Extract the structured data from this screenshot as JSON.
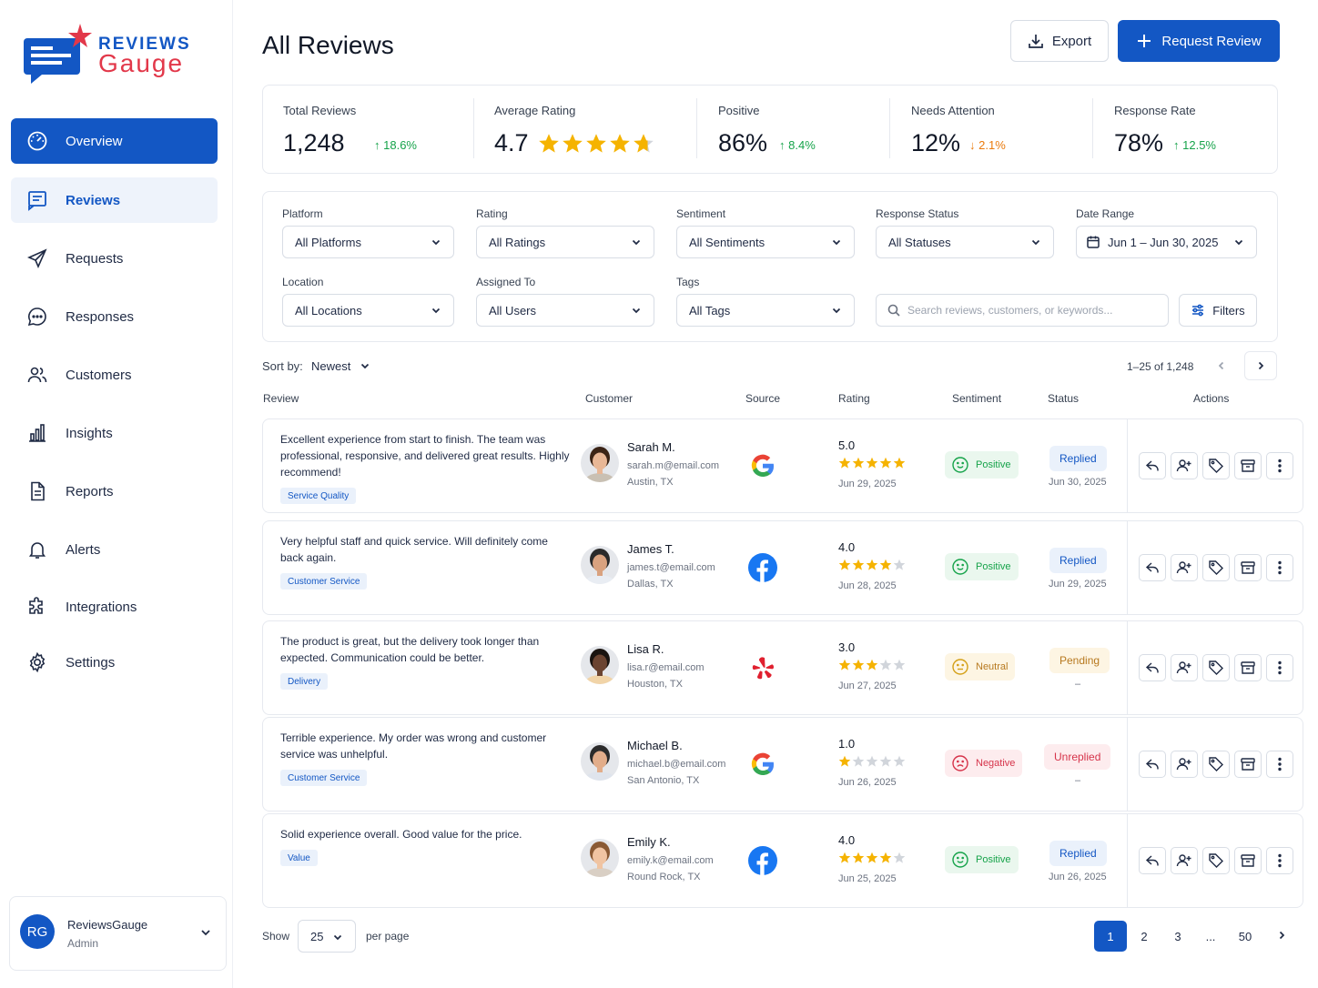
{
  "brand": {
    "line1": "REVIEWS",
    "line2": "Gauge"
  },
  "nav": [
    {
      "label": "Overview",
      "icon": "gauge-icon"
    },
    {
      "label": "Reviews",
      "icon": "review-list-icon"
    },
    {
      "label": "Requests",
      "icon": "send-icon"
    },
    {
      "label": "Responses",
      "icon": "chat-bubble-icon"
    },
    {
      "label": "Customers",
      "icon": "users-icon"
    },
    {
      "label": "Insights",
      "icon": "bar-chart-icon"
    },
    {
      "label": "Reports",
      "icon": "document-icon"
    },
    {
      "label": "Alerts",
      "icon": "bell-icon"
    },
    {
      "label": "Integrations",
      "icon": "puzzle-icon"
    },
    {
      "label": "Settings",
      "icon": "gear-icon"
    }
  ],
  "user": {
    "initials": "RG",
    "name": "ReviewsGauge",
    "role": "Admin"
  },
  "header": {
    "title": "All Reviews",
    "export_label": "Export",
    "request_label": "Request Review"
  },
  "stats": [
    {
      "label": "Total Reviews",
      "value": "1,248",
      "delta": "18.6%",
      "direction": "up"
    },
    {
      "label": "Average Rating",
      "value": "4.7",
      "rating": 4.7
    },
    {
      "label": "Positive",
      "value": "86%",
      "delta": "8.4%",
      "direction": "up"
    },
    {
      "label": "Needs Attention",
      "value": "12%",
      "delta": "2.1%",
      "direction": "down"
    },
    {
      "label": "Response Rate",
      "value": "78%",
      "delta": "12.5%",
      "direction": "up"
    }
  ],
  "filters": {
    "platform": {
      "label": "Platform",
      "value": "All Platforms"
    },
    "rating": {
      "label": "Rating",
      "value": "All Ratings"
    },
    "sentiment": {
      "label": "Sentiment",
      "value": "All Sentiments"
    },
    "response_status": {
      "label": "Response Status",
      "value": "All Statuses"
    },
    "date_range": {
      "label": "Date Range",
      "value": "Jun 1 – Jun 30, 2025"
    },
    "location": {
      "label": "Location",
      "value": "All Locations"
    },
    "assigned_to": {
      "label": "Assigned To",
      "value": "All Users"
    },
    "tags": {
      "label": "Tags",
      "value": "All Tags"
    },
    "search_placeholder": "Search reviews, customers, or keywords...",
    "filters_label": "Filters"
  },
  "sort": {
    "label": "Sort by:",
    "value": "Newest"
  },
  "range_text": "1–25 of 1,248",
  "columns": [
    "Review",
    "Customer",
    "Source",
    "Rating",
    "Sentiment",
    "Status",
    "Actions"
  ],
  "reviews": [
    {
      "text": "Excellent experience from start to finish. The team was professional, responsive, and delivered great results. Highly recommend!",
      "tag": "Service Quality",
      "name": "Sarah M.",
      "email": "sarah.m@email.com",
      "location": "Austin, TX",
      "source": "google",
      "rating": "5.0",
      "stars": 5,
      "date": "Jun 29, 2025",
      "sentiment": "Positive",
      "sentiment_type": "pos",
      "status": "Replied",
      "status_type": "replied",
      "status_date": "Jun 30, 2025"
    },
    {
      "text": "Very helpful staff and quick service. Will definitely come back again.",
      "tag": "Customer Service",
      "name": "James T.",
      "email": "james.t@email.com",
      "location": "Dallas, TX",
      "source": "facebook",
      "rating": "4.0",
      "stars": 4,
      "date": "Jun 28, 2025",
      "sentiment": "Positive",
      "sentiment_type": "pos",
      "status": "Replied",
      "status_type": "replied",
      "status_date": "Jun 29, 2025"
    },
    {
      "text": "The product is great, but the delivery took longer than expected. Communication could be better.",
      "tag": "Delivery",
      "name": "Lisa R.",
      "email": "lisa.r@email.com",
      "location": "Houston, TX",
      "source": "yelp",
      "rating": "3.0",
      "stars": 3,
      "date": "Jun 27, 2025",
      "sentiment": "Neutral",
      "sentiment_type": "neu",
      "status": "Pending",
      "status_type": "pending",
      "status_date": "–"
    },
    {
      "text": "Terrible experience. My order was wrong and customer service was unhelpful.",
      "tag": "Customer Service",
      "name": "Michael B.",
      "email": "michael.b@email.com",
      "location": "San Antonio, TX",
      "source": "google",
      "rating": "1.0",
      "stars": 1,
      "date": "Jun 26, 2025",
      "sentiment": "Negative",
      "sentiment_type": "neg",
      "status": "Unreplied",
      "status_type": "unreplied",
      "status_date": "–"
    },
    {
      "text": "Solid experience overall. Good value for the price.",
      "tag": "Value",
      "name": "Emily K.",
      "email": "emily.k@email.com",
      "location": "Round Rock, TX",
      "source": "facebook",
      "rating": "4.0",
      "stars": 4,
      "date": "Jun 25, 2025",
      "sentiment": "Positive",
      "sentiment_type": "pos",
      "status": "Replied",
      "status_type": "replied",
      "status_date": "Jun 26, 2025"
    }
  ],
  "pagination": {
    "show_label": "Show",
    "per_page": "25",
    "per_page_label": "per page",
    "pages": [
      "1",
      "2",
      "3",
      "...",
      "50"
    ],
    "current": "1"
  },
  "colors": {
    "primary": "#1357c4",
    "accent_red": "#e2384a",
    "positive": "#16a34a",
    "warning": "#ea7a0c",
    "star": "#f5b301"
  }
}
